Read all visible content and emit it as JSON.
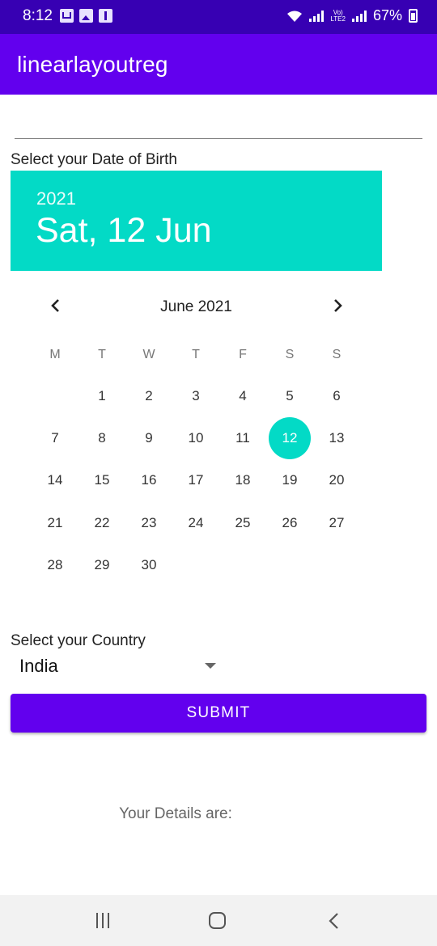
{
  "status_bar": {
    "time": "8:12",
    "battery": "67%",
    "left_icons": [
      "gmail-icon",
      "gallery-icon",
      "usb-icon"
    ],
    "right_icons": [
      "wifi-icon",
      "signal-icon",
      "volte-icon",
      "battery-icon"
    ]
  },
  "app_bar": {
    "title": "linearlayoutreg"
  },
  "name_field": {
    "value": "",
    "placeholder": ""
  },
  "dob": {
    "label": "Select your Date of Birth",
    "header_year": "2021",
    "header_date": "Sat, 12 Jun",
    "month_label": "June 2021",
    "weekdays": [
      "M",
      "T",
      "W",
      "T",
      "F",
      "S",
      "S"
    ],
    "days": [
      "1",
      "2",
      "3",
      "4",
      "5",
      "6",
      "7",
      "8",
      "9",
      "10",
      "11",
      "12",
      "13",
      "14",
      "15",
      "16",
      "17",
      "18",
      "19",
      "20",
      "21",
      "22",
      "23",
      "24",
      "25",
      "26",
      "27",
      "28",
      "29",
      "30"
    ],
    "selected_day": "12",
    "accent_color": "#03dac6"
  },
  "country": {
    "label": "Select your Country",
    "selected": "India"
  },
  "submit": {
    "label": "SUBMIT"
  },
  "details": {
    "label": "Your Details are:"
  },
  "colors": {
    "primary": "#6200ee",
    "primary_dark": "#3700b3",
    "accent": "#03dac6"
  }
}
